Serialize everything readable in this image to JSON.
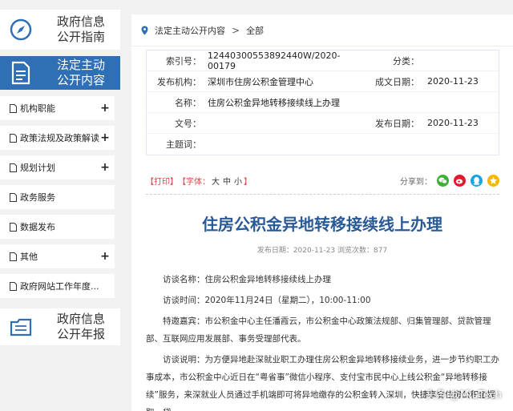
{
  "sidebar": {
    "guide_title_1": "政府信息",
    "guide_title_2": "公开指南",
    "active_title_1": "法定主动",
    "active_title_2": "公开内容",
    "report_title_1": "政府信息",
    "report_title_2": "公开年报",
    "items": [
      {
        "label": "机构职能",
        "expand": "+"
      },
      {
        "label": "政策法规及政策解读",
        "expand": "+"
      },
      {
        "label": "规划计划",
        "expand": "+"
      },
      {
        "label": "政务服务",
        "expand": ""
      },
      {
        "label": "数据发布",
        "expand": ""
      },
      {
        "label": "其他",
        "expand": "+"
      },
      {
        "label": "政府网站工作年度...",
        "expand": ""
      }
    ]
  },
  "breadcrumb": {
    "root": "法定主动公开内容",
    "separator": ">",
    "current": "全部"
  },
  "meta": {
    "index_label": "索引号：",
    "index_value": "12440300553892440W/2020-00179",
    "category_label": "分类：",
    "category_value": "",
    "publisher_label": "发布机构：",
    "publisher_value": "深圳市住房公积金管理中心",
    "created_label": "成文日期：",
    "created_value": "2020-11-23",
    "name_label": "名称：",
    "name_value": "住房公积金异地转移接续线上办理",
    "docno_label": "文号：",
    "docno_value": "",
    "published_label": "发布日期：",
    "published_value": "2020-11-23",
    "subject_label": "主题词：",
    "subject_value": ""
  },
  "toolbar": {
    "print": "【打印】",
    "font_prefix": "【字体：",
    "font_large": "大",
    "font_medium": "中",
    "font_small": "小",
    "font_suffix": "】",
    "share_label": "分享到："
  },
  "article": {
    "title": "住房公积金异地转移接续线上办理",
    "pubinfo": "发布日期：2020-11-23    浏览次数：877",
    "p1": "访谈名称：住房公积金异地转移接续线上办理",
    "p2": "访谈时间：2020年11月24日（星期二），10:00-11:00",
    "p3": "特邀嘉宾：市公积金中心主任潘霞云，市公积金中心政策法规部、归集管理部、贷款管理部、互联网应用发展部、事务受理部代表。",
    "p4": "访谈说明：为方便异地赴深就业职工办理住房公积金异地转移接续业务，进一步节约职工办事成本，市公积金中心近日在“粤省事”微信小程序、支付宝市民中心上线公积金“异地转移接续”服务，来深就业人员通过手机端即可将异地缴存的公积金转入深圳，快捷享受住房公积金提取、贷"
  },
  "watermark": "头条 @MiuTech",
  "colors": {
    "primary_blue": "#2f6fb6",
    "title_blue": "#2a5a96",
    "share_wechat": "#3cb034",
    "share_weibo": "#e6162d",
    "share_qq": "#1aa3e6",
    "share_qzone": "#f6b700"
  }
}
